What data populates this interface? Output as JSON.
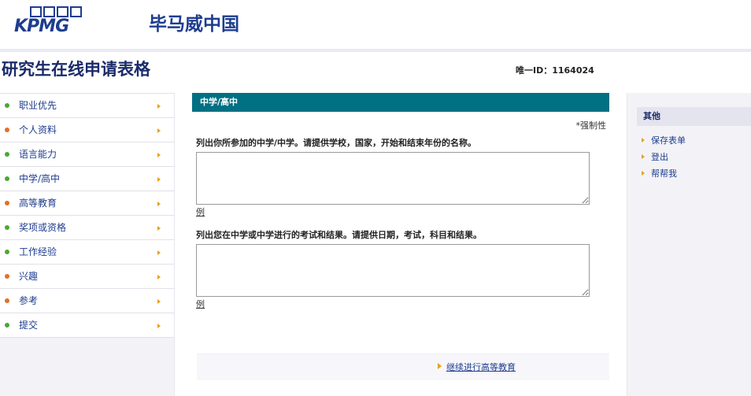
{
  "header": {
    "logo_text": "KPMG",
    "brand_cn": "毕马威中国"
  },
  "page": {
    "title": "研究生在线申请表格",
    "unique_id": "唯一ID：1164024"
  },
  "sidebar": {
    "items": [
      {
        "label": "职业优先",
        "status": "green"
      },
      {
        "label": "个人资料",
        "status": "orange"
      },
      {
        "label": "语言能力",
        "status": "green"
      },
      {
        "label": "中学/高中",
        "status": "green"
      },
      {
        "label": "高等教育",
        "status": "orange"
      },
      {
        "label": "奖项或资格",
        "status": "green"
      },
      {
        "label": "工作经验",
        "status": "green"
      },
      {
        "label": "兴趣",
        "status": "orange"
      },
      {
        "label": "参考",
        "status": "orange"
      },
      {
        "label": "提交",
        "status": "green"
      }
    ]
  },
  "main": {
    "section_title": "中学/高中",
    "mandatory_note": "*强制性",
    "question1": "列出你所参加的中学/中学。请提供学校，国家，开始和结束年份的名称。",
    "question1_value": "",
    "example1": "例",
    "question2": "列出您在中学或中学进行的考试和结果。请提供日期，考试，科目和结果。",
    "question2_value": "",
    "example2": "例",
    "continue_label": "继续进行高等教育"
  },
  "right": {
    "title": "其他",
    "links": [
      "保存表单",
      "登出",
      "帮帮我"
    ]
  },
  "colors": {
    "brand_blue": "#1e3d8f",
    "section_teal": "#007083",
    "arrow_orange": "#e8a020",
    "status_green": "#4aa832",
    "status_orange": "#e0702a"
  }
}
